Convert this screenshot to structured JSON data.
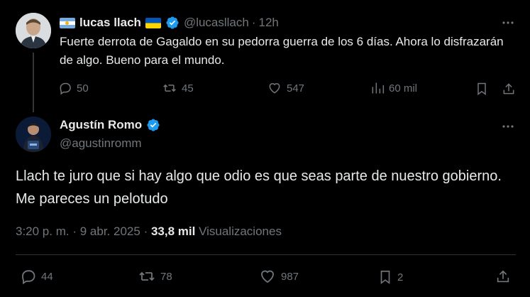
{
  "reply_to_tweet": {
    "author_name": "lucas llach",
    "handle": "@lucasllach",
    "separator": "·",
    "time": "12h",
    "text": "Fuerte derrota de Gagaldo en su pedorra guerra de los 6 días. Ahora lo disfrazarán de algo. Bueno para el mundo.",
    "replies": "50",
    "reposts": "45",
    "likes": "547",
    "views": "60 mil"
  },
  "main_tweet": {
    "author_name": "Agustín Romo",
    "handle": "@agustinromm",
    "text": "Llach te juro que si hay algo que odio es que seas parte de nuestro gobierno. Me pareces un pelotudo",
    "time": "3:20 p. m.",
    "separator": "·",
    "date": "9 abr. 2025",
    "separator2": "·",
    "views_count": "33,8 mil",
    "views_label": "Visualizaciones",
    "replies": "44",
    "reposts": "78",
    "likes": "987",
    "bookmarks": "2"
  },
  "icons": {
    "verified": "verified-badge-icon",
    "more": "more-dots-icon",
    "reply": "reply-icon",
    "repost": "repost-icon",
    "like": "heart-icon",
    "views": "analytics-icon",
    "bookmark": "bookmark-icon",
    "share": "share-icon"
  },
  "colors": {
    "background": "#000000",
    "text": "#e7e9ea",
    "muted": "#71767b",
    "verified": "#1d9bf0",
    "divider": "#2f3336"
  }
}
